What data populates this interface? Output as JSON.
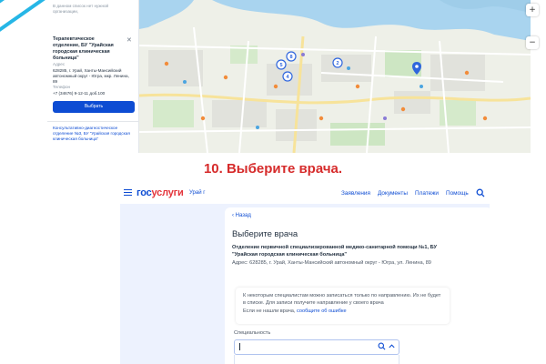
{
  "colors": {
    "accent": "#0d4cd3",
    "brand_red": "#e4343b",
    "caption_red": "#d62b2b",
    "stripe": "#26b6e6",
    "page_bg": "#edf2fe",
    "map_marker": "#2f66dd"
  },
  "top_screenshot": {
    "card": {
      "top_note": "В данном список нет нужной организации,",
      "title": "Терапевтическое отделение, БУ \"Урайская городская клиническая больница\"",
      "close_icon": "close-icon",
      "address_label": "Адрес",
      "address": "628285, г. Урай, Ханты-Мансийский автономный округ - Югра, мкр. Ленина, 89",
      "phone_label": "Телефон",
      "phone": "+7 (34676) 9-12-11 доб.100",
      "select_button": "Выбрать",
      "next_org": "Консультативно-диагностическое отделение №3, БУ \"Урайская городская клиническая больница\""
    },
    "map": {
      "markers": [
        "8",
        "5",
        "4",
        "2"
      ],
      "controls": [
        "+",
        "−"
      ]
    }
  },
  "caption": "10. Выберите врача.",
  "bottom_screenshot": {
    "header": {
      "logo_part1": "гос",
      "logo_part2": "услуги",
      "region": "Урай г",
      "nav": [
        "Заявления",
        "Документы",
        "Платежи",
        "Помощь"
      ],
      "search_icon": "search-icon",
      "menu_icon": "menu-icon"
    },
    "back_link": "‹ Назад",
    "page_title": "Выберите врача",
    "department": "Отделение первичной специализированной медико-санитарной помощи №1, БУ \"Урайская городская клиническая больница\"",
    "address": "Адрес: 628285, г. Урай, Ханты-Мансийский автономный округ - Югра, ул. Ленина, 89",
    "info_text": "К некоторым специалистам можно записаться только по направлению. Их не будет в списке. Для записи получите направление у своего врача",
    "info_link_prefix": "Если не нашли врача,",
    "info_link": "сообщите об ошибке",
    "specialty_label": "Специальность",
    "specialty_value": ""
  }
}
